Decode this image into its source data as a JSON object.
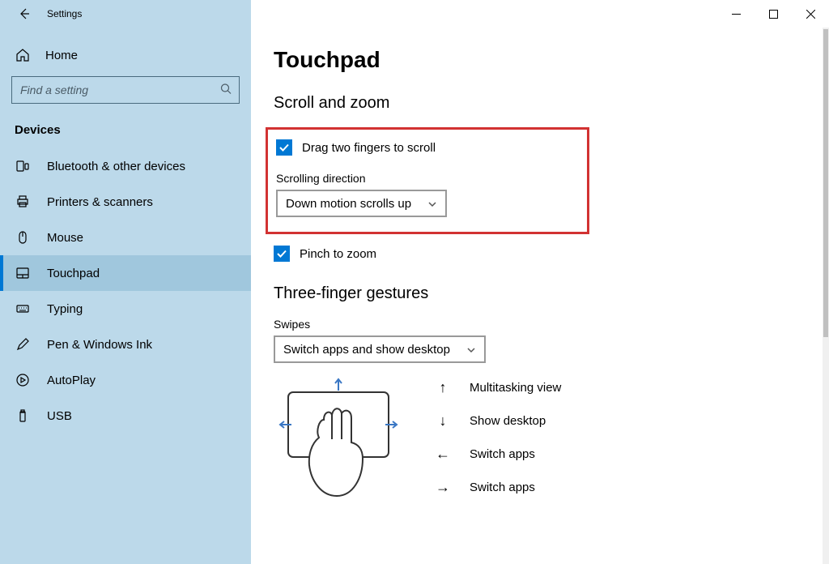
{
  "titlebar": {
    "title": "Settings"
  },
  "sidebar": {
    "home": "Home",
    "search_placeholder": "Find a setting",
    "category": "Devices",
    "items": [
      {
        "label": "Bluetooth & other devices"
      },
      {
        "label": "Printers & scanners"
      },
      {
        "label": "Mouse"
      },
      {
        "label": "Touchpad"
      },
      {
        "label": "Typing"
      },
      {
        "label": "Pen & Windows Ink"
      },
      {
        "label": "AutoPlay"
      },
      {
        "label": "USB"
      }
    ]
  },
  "main": {
    "title": "Touchpad",
    "scroll_zoom_heading": "Scroll and zoom",
    "drag_two_fingers": "Drag two fingers to scroll",
    "scroll_direction_label": "Scrolling direction",
    "scroll_direction_value": "Down motion scrolls up",
    "pinch_to_zoom": "Pinch to zoom",
    "three_finger_heading": "Three-finger gestures",
    "swipes_label": "Swipes",
    "swipes_value": "Switch apps and show desktop",
    "gestures": [
      {
        "arrow": "↑",
        "label": "Multitasking view"
      },
      {
        "arrow": "↓",
        "label": "Show desktop"
      },
      {
        "arrow": "←",
        "label": "Switch apps"
      },
      {
        "arrow": "→",
        "label": "Switch apps"
      }
    ]
  }
}
